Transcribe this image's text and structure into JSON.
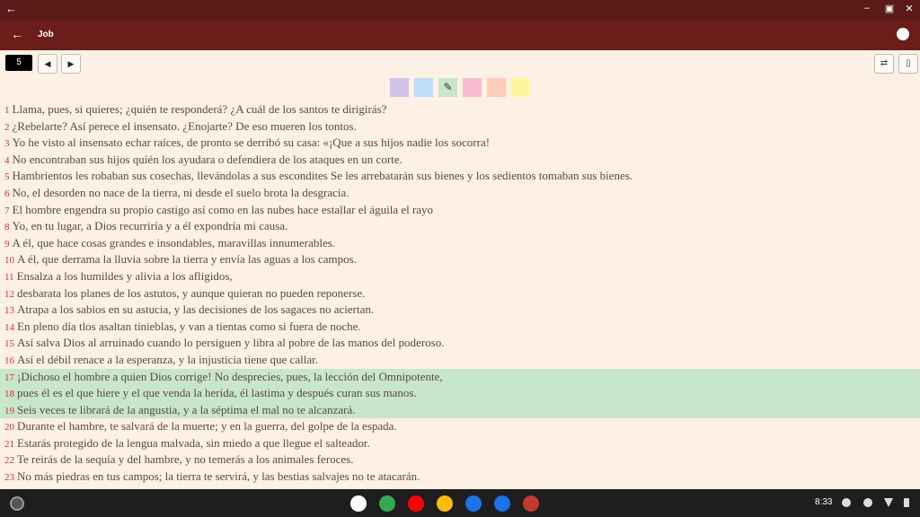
{
  "window": {
    "back_glyph": "←",
    "controls": [
      "–",
      "▣",
      "✕"
    ]
  },
  "appbar": {
    "title": "Job",
    "back_glyph": "←",
    "menu_icon": "menu-icon"
  },
  "toolbar": {
    "chapter": "5",
    "prev": "◀",
    "next": "▶",
    "right_tools": [
      "⇄",
      "▯"
    ]
  },
  "highlight_colors": [
    "#d1c4e9",
    "#bbdefb",
    "#c8e6c9",
    "#f8bbd0",
    "#ffccbc",
    "#fff59d"
  ],
  "verses": [
    {
      "n": "1",
      "t": "Llama, pues, si quieres; ¿quién te responderá? ¿A cuál de los santos te dirigirás?",
      "hl": false
    },
    {
      "n": "2",
      "t": "¿Rebelarte? Así perece el insensato. ¿Enojarte? De eso mueren los tontos.",
      "hl": false
    },
    {
      "n": "3",
      "t": "Yo he visto al insensato echar raíces, de pronto se derribó su casa: «¡Que a sus hijos nadie los socorra!",
      "hl": false
    },
    {
      "n": "4",
      "t": "No encontraban sus hijos quién los ayudara o defendiera de los ataques en un corte.",
      "hl": false
    },
    {
      "n": "5",
      "t": "Hambrientos les robaban sus cosechas, llevándolas a sus escondites Se les arrebatarán sus bienes y los sedientos tomaban sus bienes.",
      "hl": false
    },
    {
      "n": "6",
      "t": "No, el desorden no nace de la tierra, ni desde el suelo brota la desgracia.",
      "hl": false
    },
    {
      "n": "7",
      "t": "El hombre engendra su propio castigo así como en las nubes hace estallar el águila el rayo",
      "hl": false
    },
    {
      "n": "8",
      "t": "Yo, en tu lugar, a Dios recurriría y a él expondría mi causa.",
      "hl": false
    },
    {
      "n": "9",
      "t": "A él, que hace cosas grandes e insondables, maravillas innumerables.",
      "hl": false
    },
    {
      "n": "10",
      "t": "A él, que derrama la lluvia sobre la tierra y envía las aguas a los campos.",
      "hl": false
    },
    {
      "n": "11",
      "t": "Ensalza a los humildes y alivia a los afligidos,",
      "hl": false
    },
    {
      "n": "12",
      "t": "desbarata los planes de los astutos, y aunque quieran no pueden reponerse.",
      "hl": false
    },
    {
      "n": "13",
      "t": "Atrapa a los sabios en su astucia, y las decisiones de los sagaces no aciertan.",
      "hl": false
    },
    {
      "n": "14",
      "t": "En pleno día tlos asaltan tinieblas, y van a tientas como si fuera de noche.",
      "hl": false
    },
    {
      "n": "15",
      "t": "Así salva Dios al arruinado cuando lo persiguen y libra al pobre de las manos del poderoso.",
      "hl": false
    },
    {
      "n": "16",
      "t": "Así el débil renace a la esperanza, y la injusticia tiene que callar.",
      "hl": false
    },
    {
      "n": "17",
      "t": "¡Dichoso el hombre a quien Dios corrige! No desprecies, pues, la lección del Omnipotente,",
      "hl": true
    },
    {
      "n": "18",
      "t": "pues él es el que hiere y el que venda la herida, él lastima y después curan sus manos.",
      "hl": true
    },
    {
      "n": "19",
      "t": "Seis veces te librará de la angustia, y a la séptima el mal no te alcanzará.",
      "hl": true
    },
    {
      "n": "20",
      "t": "Durante el hambre, te salvará de la muerte; y en la guerra, del golpe de la espada.",
      "hl": false
    },
    {
      "n": "21",
      "t": "Estarás protegido de la lengua malvada, sin miedo a que llegue el salteador.",
      "hl": false
    },
    {
      "n": "22",
      "t": "Te reirás de la sequía y del hambre, y no temerás a los animales feroces.",
      "hl": false
    },
    {
      "n": "23",
      "t": "No más piedras en tus campos; la tierra te servirá, y las bestias salvajes no te atacarán.",
      "hl": false
    }
  ],
  "shelf": {
    "apps": [
      {
        "name": "gmail-icon",
        "color": "#ffffff"
      },
      {
        "name": "chrome-icon",
        "color": "#34a853"
      },
      {
        "name": "youtube-icon",
        "color": "#ff0000"
      },
      {
        "name": "photos-icon",
        "color": "#fbbc05"
      },
      {
        "name": "messages-icon",
        "color": "#1a73e8"
      },
      {
        "name": "phone-icon",
        "color": "#1a73e8"
      },
      {
        "name": "bible-app-icon",
        "color": "#c0392b"
      }
    ],
    "time": "8:33"
  }
}
